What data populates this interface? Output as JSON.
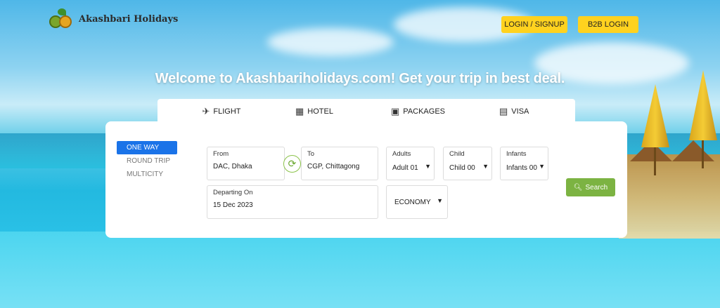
{
  "brand": {
    "name": "Akashbari Holidays"
  },
  "header": {
    "login_label": "LOGIN / SIGNUP",
    "b2b_label": "B2B LOGIN"
  },
  "hero": {
    "welcome": "Welcome to Akashbariholidays.com! Get your trip in best deal."
  },
  "tabs": [
    {
      "label": "FLIGHT",
      "icon": "airplane-icon",
      "active": true
    },
    {
      "label": "HOTEL",
      "icon": "hotel-icon",
      "active": false
    },
    {
      "label": "PACKAGES",
      "icon": "package-icon",
      "active": false
    },
    {
      "label": "VISA",
      "icon": "visa-card-icon",
      "active": false
    }
  ],
  "trip_types": [
    {
      "label": "ONE WAY",
      "active": true
    },
    {
      "label": "ROUND TRIP",
      "active": false
    },
    {
      "label": "MULTICITY",
      "active": false
    }
  ],
  "search": {
    "from": {
      "label": "From",
      "value": "DAC, Dhaka"
    },
    "to": {
      "label": "To",
      "value": "CGP, Chittagong"
    },
    "adults": {
      "label": "Adults",
      "value": "Adult 01"
    },
    "child": {
      "label": "Child",
      "value": "Child 00"
    },
    "infants": {
      "label": "Infants",
      "value": "Infants 00"
    },
    "departing": {
      "label": "Departing On",
      "value": "15 Dec 2023"
    },
    "cabin_class": {
      "value": "ECONOMY"
    },
    "button_label": "Search"
  },
  "colors": {
    "accent_yellow": "#ffd21f",
    "active_blue": "#1a73e8",
    "search_green": "#7cb342"
  }
}
